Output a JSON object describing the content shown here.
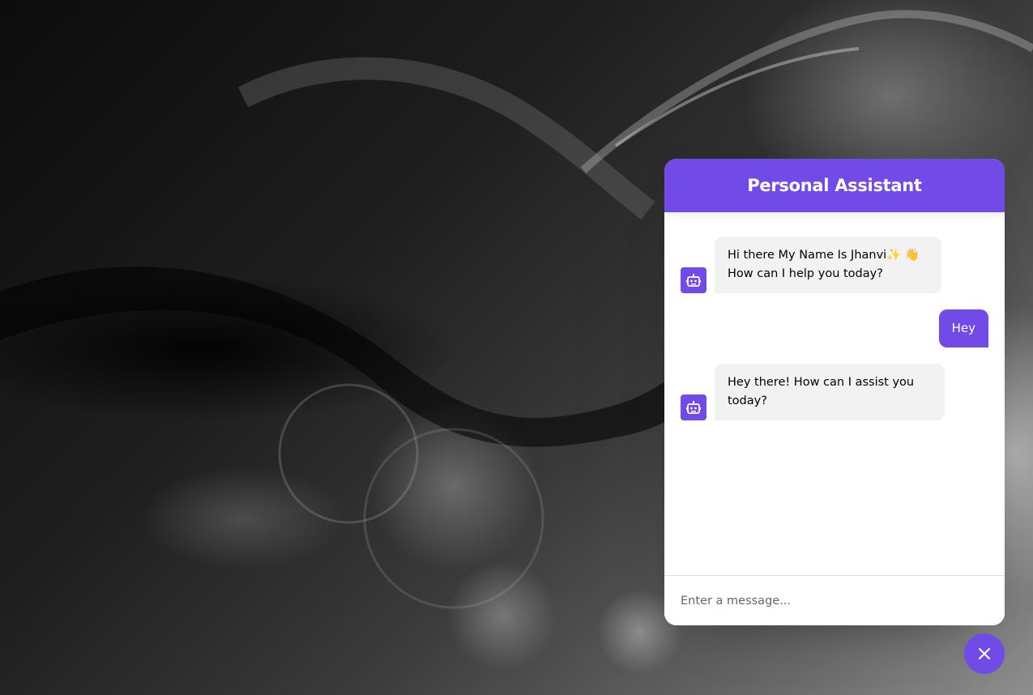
{
  "colors": {
    "accent": "#724ae8",
    "incoming_bubble": "#f2f2f2",
    "outgoing_text": "#ffffff"
  },
  "header": {
    "title": "Personal Assistant"
  },
  "messages": [
    {
      "direction": "incoming",
      "avatar_icon": "robot-icon",
      "text": "Hi there My Name Is Jhanvi✨ 👋\nHow can I help you today?"
    },
    {
      "direction": "outgoing",
      "text": "Hey"
    },
    {
      "direction": "incoming",
      "avatar_icon": "robot-icon",
      "text": "Hey there! How can I assist you today?"
    }
  ],
  "input": {
    "placeholder": "Enter a message...",
    "value": ""
  },
  "toggler": {
    "icon": "close-icon"
  }
}
